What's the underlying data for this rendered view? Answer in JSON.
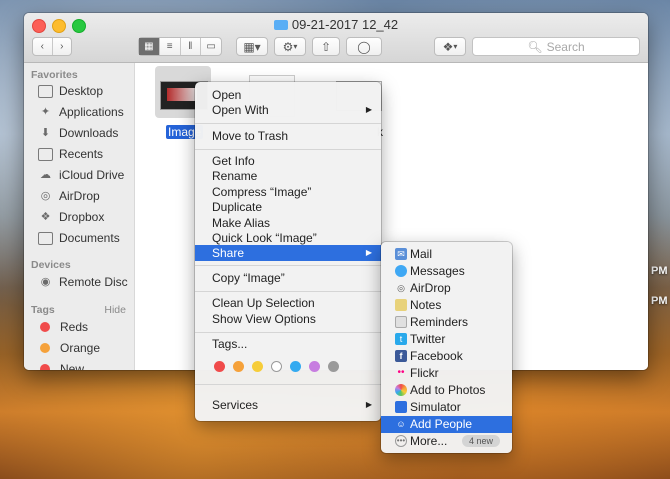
{
  "desktop": {
    "pm_label": "PM"
  },
  "window": {
    "title": "09-21-2017 12_42",
    "search_placeholder": "Search",
    "toolbar": {
      "action_label": "⚙",
      "share_label": "⇧",
      "tag_label": "◯",
      "dropbox_label": "❖"
    }
  },
  "sidebar": {
    "favorites_heading": "Favorites",
    "favorites": [
      {
        "label": "Desktop",
        "icon": "desktop-icon"
      },
      {
        "label": "Applications",
        "icon": "applications-icon"
      },
      {
        "label": "Downloads",
        "icon": "downloads-icon"
      },
      {
        "label": "Recents",
        "icon": "recents-icon"
      },
      {
        "label": "iCloud Drive",
        "icon": "cloud-icon"
      },
      {
        "label": "AirDrop",
        "icon": "airdrop-icon"
      },
      {
        "label": "Dropbox",
        "icon": "dropbox-icon"
      },
      {
        "label": "Documents",
        "icon": "documents-icon"
      }
    ],
    "devices_heading": "Devices",
    "devices": [
      {
        "label": "Remote Disc",
        "icon": "disc-icon"
      }
    ],
    "tags_heading": "Tags",
    "tags_hide": "Hide",
    "tags": [
      {
        "label": "Reds",
        "color": "#f04b4b"
      },
      {
        "label": "Orange",
        "color": "#f5a13a"
      },
      {
        "label": "New",
        "color": "#f04b4b"
      }
    ]
  },
  "files": {
    "selected_name": "Image",
    "third_name": "k"
  },
  "context_menu": {
    "open": "Open",
    "open_with": "Open With",
    "move_to_trash": "Move to Trash",
    "get_info": "Get Info",
    "rename": "Rename",
    "compress": "Compress “Image”",
    "duplicate": "Duplicate",
    "make_alias": "Make Alias",
    "quick_look": "Quick Look “Image”",
    "share": "Share",
    "copy": "Copy “Image”",
    "clean_up": "Clean Up Selection",
    "view_options": "Show View Options",
    "tags": "Tags...",
    "tag_colors": [
      "#f04b4b",
      "#f5a13a",
      "#f6cd3a",
      "#ffffff",
      "#34aaf0",
      "#c77de0",
      "#9a9a9a"
    ],
    "services": "Services"
  },
  "share_menu": {
    "items": [
      {
        "label": "Mail",
        "icon": "mail-icon",
        "color": "#5a8fd8"
      },
      {
        "label": "Messages",
        "icon": "messages-icon",
        "color": "#3fa8f4"
      },
      {
        "label": "AirDrop",
        "icon": "airdrop-icon",
        "color": "#8a8a8a"
      },
      {
        "label": "Notes",
        "icon": "notes-icon",
        "color": "#e8d27a"
      },
      {
        "label": "Reminders",
        "icon": "reminders-icon",
        "color": "#cfcfcf"
      },
      {
        "label": "Twitter",
        "icon": "twitter-icon",
        "color": "#29a9eb"
      },
      {
        "label": "Facebook",
        "icon": "facebook-icon",
        "color": "#3b5998"
      },
      {
        "label": "Flickr",
        "icon": "flickr-icon",
        "color": "#ff0084"
      },
      {
        "label": "Add to Photos",
        "icon": "photos-icon",
        "color": "#f0a030"
      },
      {
        "label": "Simulator",
        "icon": "simulator-icon",
        "color": "#2d6fdf"
      },
      {
        "label": "Add People",
        "icon": "add-people-icon",
        "color": "#ffffff"
      },
      {
        "label": "More...",
        "icon": "more-icon",
        "color": "#9a9a9a"
      }
    ],
    "badge": "4 new"
  }
}
